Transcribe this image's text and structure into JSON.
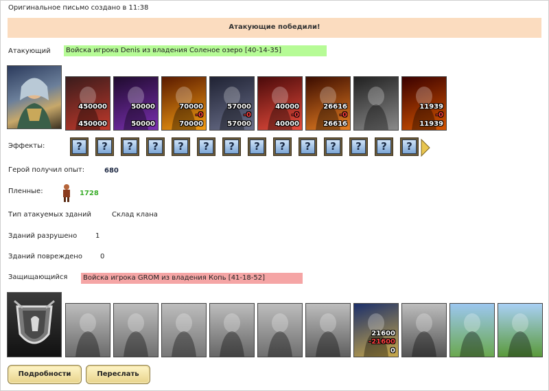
{
  "header": {
    "created": "Оригинальное письмо создано в 11:38"
  },
  "banner": "Атакующие победили!",
  "attacker": {
    "label": "Атакующий",
    "army": "Войска игрока Denis из владения Соленое озеро [40-14-35]",
    "units": [
      {
        "icon": "dragon-unit-icon",
        "count": "450000",
        "loss": "",
        "remain": "450000",
        "colors": [
          "#3a1c1c",
          "#c0392b"
        ]
      },
      {
        "icon": "demon-unit-icon",
        "count": "50000",
        "loss": "",
        "remain": "50000",
        "colors": [
          "#1f0b2e",
          "#7a2fb0"
        ]
      },
      {
        "icon": "fire-beast-unit-icon",
        "count": "70000",
        "loss": "-0",
        "remain": "70000",
        "colors": [
          "#5a1a00",
          "#f39c12"
        ]
      },
      {
        "icon": "gargoyle-unit-icon",
        "count": "57000",
        "loss": "-0",
        "remain": "57000",
        "colors": [
          "#1f2233",
          "#6a6f8a"
        ]
      },
      {
        "icon": "fire-elemental-unit-icon",
        "count": "40000",
        "loss": "-0",
        "remain": "40000",
        "colors": [
          "#4a0a0a",
          "#e74c3c"
        ]
      },
      {
        "icon": "pit-lord-unit-icon",
        "count": "26616",
        "loss": "-0",
        "remain": "26616",
        "colors": [
          "#3b0c00",
          "#e67e22"
        ]
      },
      {
        "icon": "horned-demon-unit-icon",
        "count": "",
        "loss": "",
        "remain": "",
        "colors": [
          "#202020",
          "#8a8a8a"
        ]
      },
      {
        "icon": "devil-unit-icon",
        "count": "11939",
        "loss": "-0",
        "remain": "11939",
        "colors": [
          "#3a0000",
          "#d35400"
        ]
      }
    ]
  },
  "effects": {
    "label": "Эффекты:",
    "items": [
      "?",
      "?",
      "?",
      "?",
      "?",
      "?",
      "?",
      "?",
      "?",
      "?",
      "?",
      "?",
      "?",
      "?"
    ]
  },
  "experience": {
    "label": "Герой получил опыт:",
    "value": "680"
  },
  "prisoners": {
    "label": "Пленные:",
    "value": "1728"
  },
  "buildings": {
    "type_label": "Тип атакуемых зданий",
    "type_value": "Склад клана",
    "destroyed_label": "Зданий разрушено",
    "destroyed_value": "1",
    "damaged_label": "Зданий повреждено",
    "damaged_value": "0"
  },
  "defender": {
    "label": "Защищающийся",
    "army": "Войска игрока GROM из владения Копь [41-18-52]",
    "units": [
      {
        "icon": "knight-unit-icon",
        "count": "",
        "loss": "",
        "remain": ""
      },
      {
        "icon": "pikeman-unit-icon",
        "count": "",
        "loss": "",
        "remain": ""
      },
      {
        "icon": "cavalier-unit-icon",
        "count": "",
        "loss": "",
        "remain": ""
      },
      {
        "icon": "griffin-unit-icon",
        "count": "",
        "loss": "",
        "remain": ""
      },
      {
        "icon": "crossbowman-unit-icon",
        "count": "",
        "loss": "",
        "remain": ""
      },
      {
        "icon": "monk-unit-icon",
        "count": "",
        "loss": "",
        "remain": ""
      },
      {
        "icon": "mage-unit-icon",
        "count": "21600",
        "loss": "-21600",
        "remain": "0"
      },
      {
        "icon": "reaper-unit-icon",
        "count": "",
        "loss": "",
        "remain": ""
      },
      {
        "icon": "tower-building-icon",
        "count": "",
        "loss": "",
        "remain": ""
      },
      {
        "icon": "tree-city-building-icon",
        "count": "",
        "loss": "",
        "remain": ""
      }
    ]
  },
  "buttons": {
    "details": "Подробности",
    "forward": "Переслать"
  }
}
